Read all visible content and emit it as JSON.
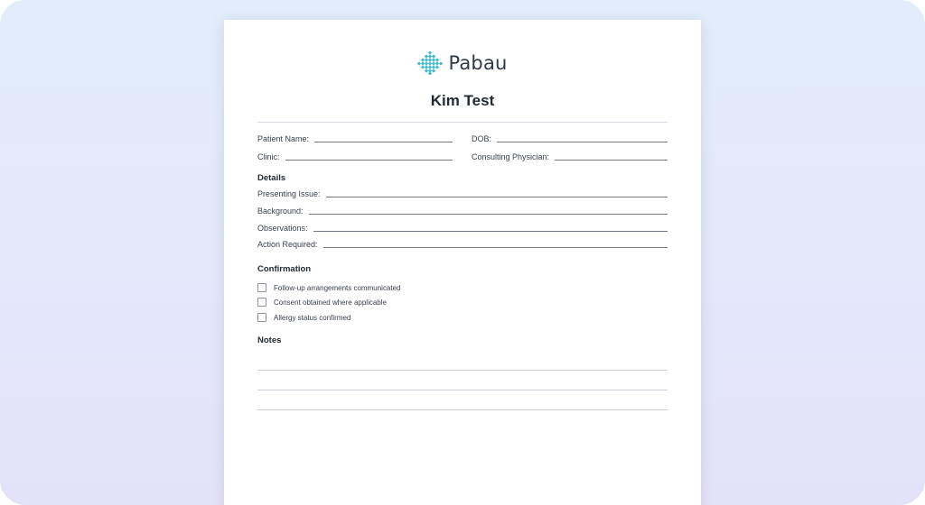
{
  "brand": {
    "name": "Pabau",
    "logo_color": "#3fb8d0"
  },
  "form": {
    "title": "Kim Test",
    "fields": {
      "patient_name": "Patient Name:",
      "dob": "DOB:",
      "clinic": "Clinic:",
      "consulting_physician": "Consulting Physician:"
    },
    "details": {
      "heading": "Details",
      "items": [
        "Presenting Issue:",
        "Background:",
        "Observations:",
        "Action Required:"
      ]
    },
    "confirmation": {
      "heading": "Confirmation",
      "items": [
        {
          "label": "Follow-up arrangements communicated",
          "checked": false
        },
        {
          "label": "Consent obtained where applicable",
          "checked": false
        },
        {
          "label": "Allergy status confirmed",
          "checked": false
        }
      ]
    },
    "notes": {
      "heading": "Notes"
    }
  }
}
